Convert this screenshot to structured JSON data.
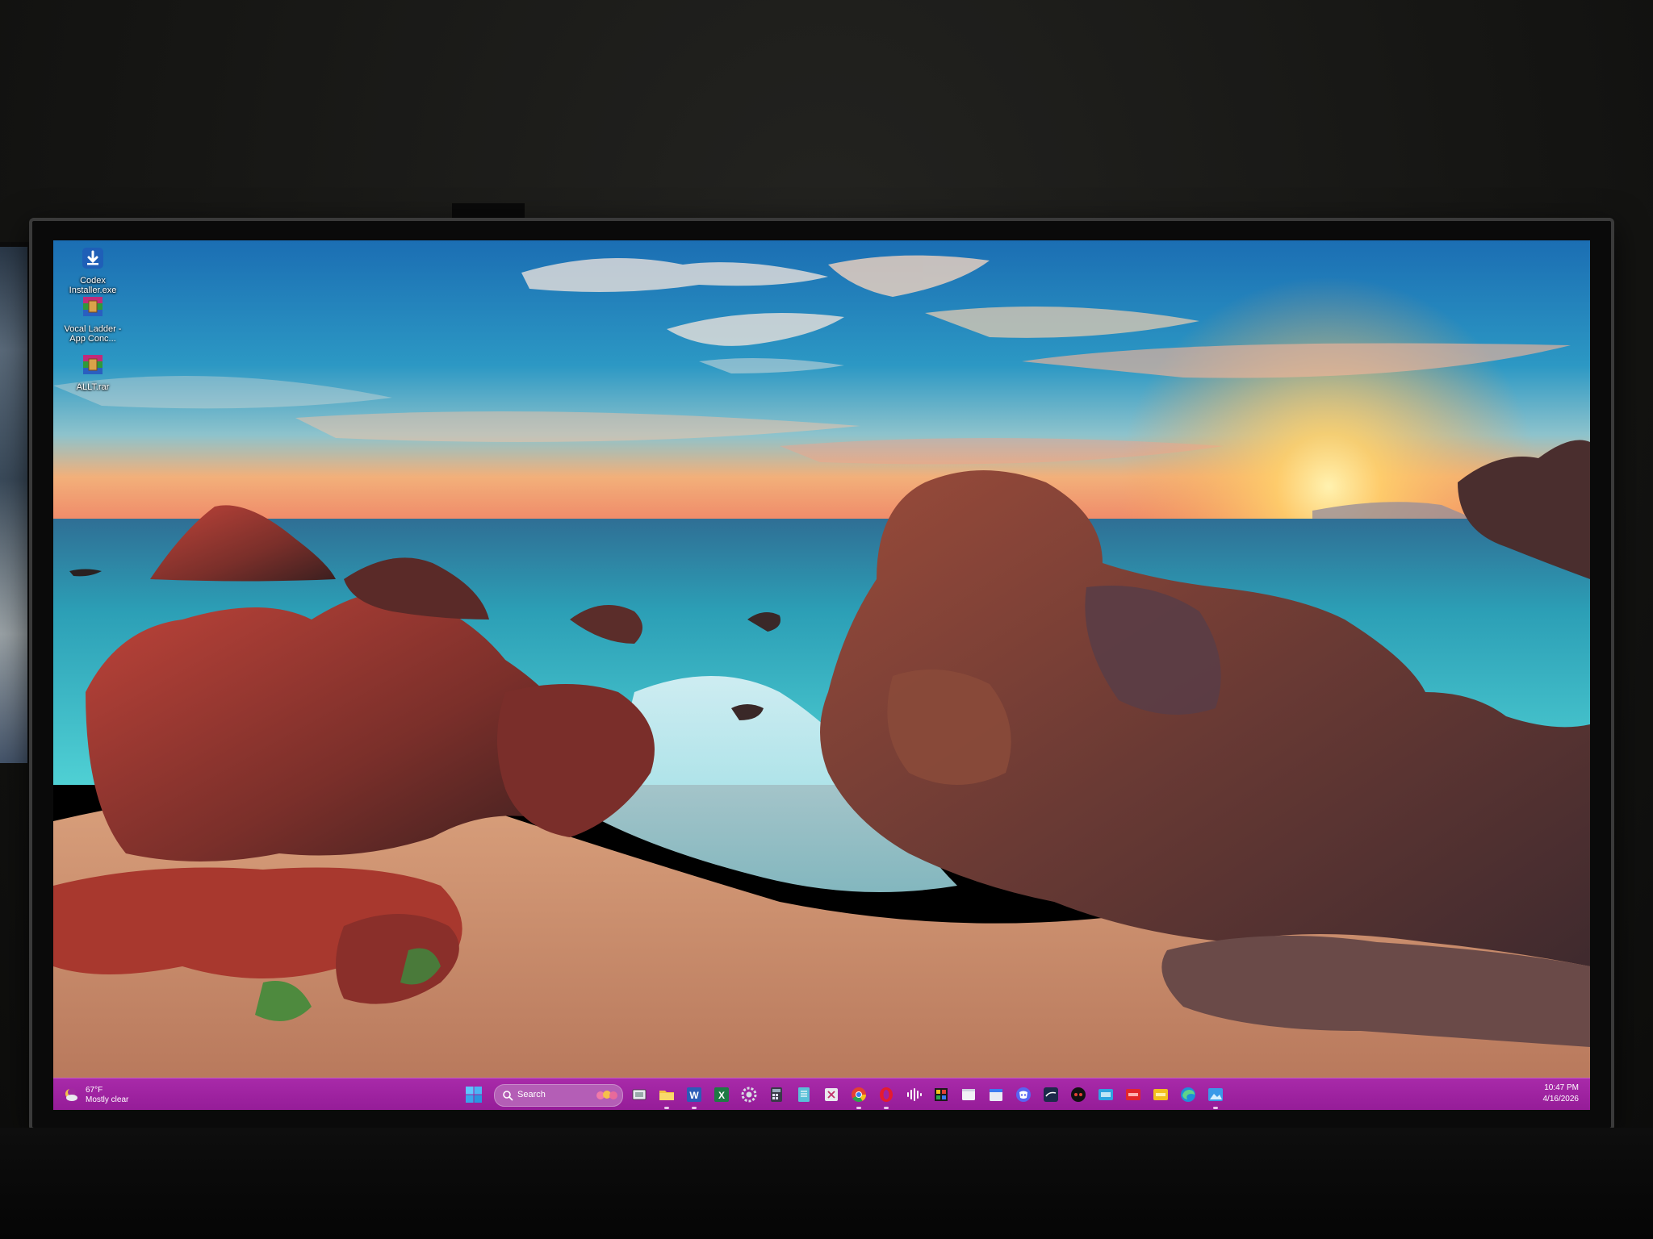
{
  "desktop": {
    "icons": [
      {
        "name": "codex-installer",
        "label": "Codex Installer.exe",
        "icon": "download-icon"
      },
      {
        "name": "vocal-ladder",
        "label": "Vocal Ladder - App Conc...",
        "icon": "rar-archive-icon"
      },
      {
        "name": "allt",
        "label": "ALLT.rar",
        "icon": "rar-archive-icon"
      }
    ]
  },
  "taskbar": {
    "color": "#a0229f",
    "weather": {
      "temp": "67°F",
      "condition": "Mostly clear",
      "icon": "moon-cloud-icon"
    },
    "search": {
      "placeholder": "Search"
    },
    "apps": [
      {
        "name": "task-view",
        "icon": "task-view-icon"
      },
      {
        "name": "file-explorer",
        "icon": "folder-icon",
        "running": true
      },
      {
        "name": "word",
        "icon": "word-icon",
        "running": true
      },
      {
        "name": "excel",
        "icon": "excel-icon"
      },
      {
        "name": "settings",
        "icon": "gear-icon"
      },
      {
        "name": "calculator",
        "icon": "calculator-icon"
      },
      {
        "name": "notepad",
        "icon": "notepad-icon"
      },
      {
        "name": "snipping-tool",
        "icon": "snipping-icon"
      },
      {
        "name": "chrome",
        "icon": "chrome-icon",
        "running": true
      },
      {
        "name": "opera",
        "icon": "opera-icon",
        "running": true
      },
      {
        "name": "audio-app",
        "icon": "waveform-icon"
      },
      {
        "name": "media-app",
        "icon": "media-icon"
      },
      {
        "name": "white-window",
        "icon": "window-icon"
      },
      {
        "name": "calendar",
        "icon": "calendar-icon"
      },
      {
        "name": "discord",
        "icon": "discord-icon"
      },
      {
        "name": "fender-tone",
        "icon": "fender-icon"
      },
      {
        "name": "focusrite",
        "icon": "dots-circle-icon"
      },
      {
        "name": "app-blue",
        "icon": "blue-app-icon"
      },
      {
        "name": "app-red",
        "icon": "red-app-icon"
      },
      {
        "name": "app-yellow",
        "icon": "yellow-app-icon"
      },
      {
        "name": "edge",
        "icon": "edge-icon"
      },
      {
        "name": "photos",
        "icon": "photos-icon",
        "running": true
      }
    ],
    "clock": {
      "time": "10:47 PM",
      "date": "4/16/2026"
    }
  },
  "colors": {
    "taskbar": "#a0229f",
    "sky_top": "#1f6fb0",
    "sea": "#3fb7c3",
    "rock": "#8a3a2c",
    "sand": "#c98d6a"
  }
}
